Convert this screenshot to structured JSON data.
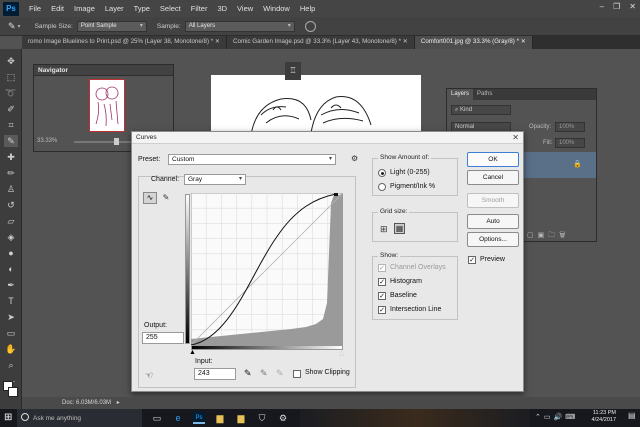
{
  "app": {
    "logo": "Ps"
  },
  "menu": [
    "File",
    "Edit",
    "Image",
    "Layer",
    "Type",
    "Select",
    "Filter",
    "3D",
    "View",
    "Window",
    "Help"
  ],
  "options_bar": {
    "sample_size_label": "Sample Size:",
    "sample_size_value": "Point Sample",
    "sample_label": "Sample:",
    "sample_value": "All Layers"
  },
  "tabs": [
    {
      "label": "romo Image Bluelines to Print.psd @ 25% (Layer 38, Monotone/8) *",
      "active": false
    },
    {
      "label": "Comic Garden Image.psd @ 33.3% (Layer 43, Monotone/8) *",
      "active": false
    },
    {
      "label": "Comfort001.jpg @ 33.3% (Gray/8) *",
      "active": true
    }
  ],
  "navigator": {
    "title": "Navigator",
    "zoom": "33.33%"
  },
  "layers_panel": {
    "tabs": [
      "Layers",
      "Paths"
    ],
    "kind": "Kind",
    "blend_mode": "Normal",
    "opacity_label": "Opacity:",
    "opacity_value": "100%",
    "fill_label": "Fill:",
    "fill_value": "100%"
  },
  "curves": {
    "title": "Curves",
    "preset_label": "Preset:",
    "preset_value": "Custom",
    "channel_label": "Channel:",
    "channel_value": "Gray",
    "output_label": "Output:",
    "output_value": "255",
    "input_label": "Input:",
    "input_value": "243",
    "show_clipping": "Show Clipping",
    "show_amount_title": "Show Amount of:",
    "light_option": "Light  (0-255)",
    "pigment_option": "Pigment/Ink %",
    "grid_size_title": "Grid size:",
    "show_title": "Show:",
    "channel_overlays": "Channel Overlays",
    "histogram": "Histogram",
    "baseline": "Baseline",
    "intersection_line": "Intersection Line",
    "buttons": {
      "ok": "OK",
      "cancel": "Cancel",
      "smooth": "Smooth",
      "auto": "Auto",
      "options": "Options..."
    },
    "preview": "Preview"
  },
  "status": {
    "doc": "Doc: 6.03M/6.03M"
  },
  "taskbar": {
    "search_placeholder": "Ask me anything",
    "time": "11:23 PM",
    "date": "4/24/2017"
  },
  "colors": {
    "accent": "#31a8ff",
    "dialog_bg": "#e8e8e8",
    "selected_layer": "#5a6f88"
  }
}
